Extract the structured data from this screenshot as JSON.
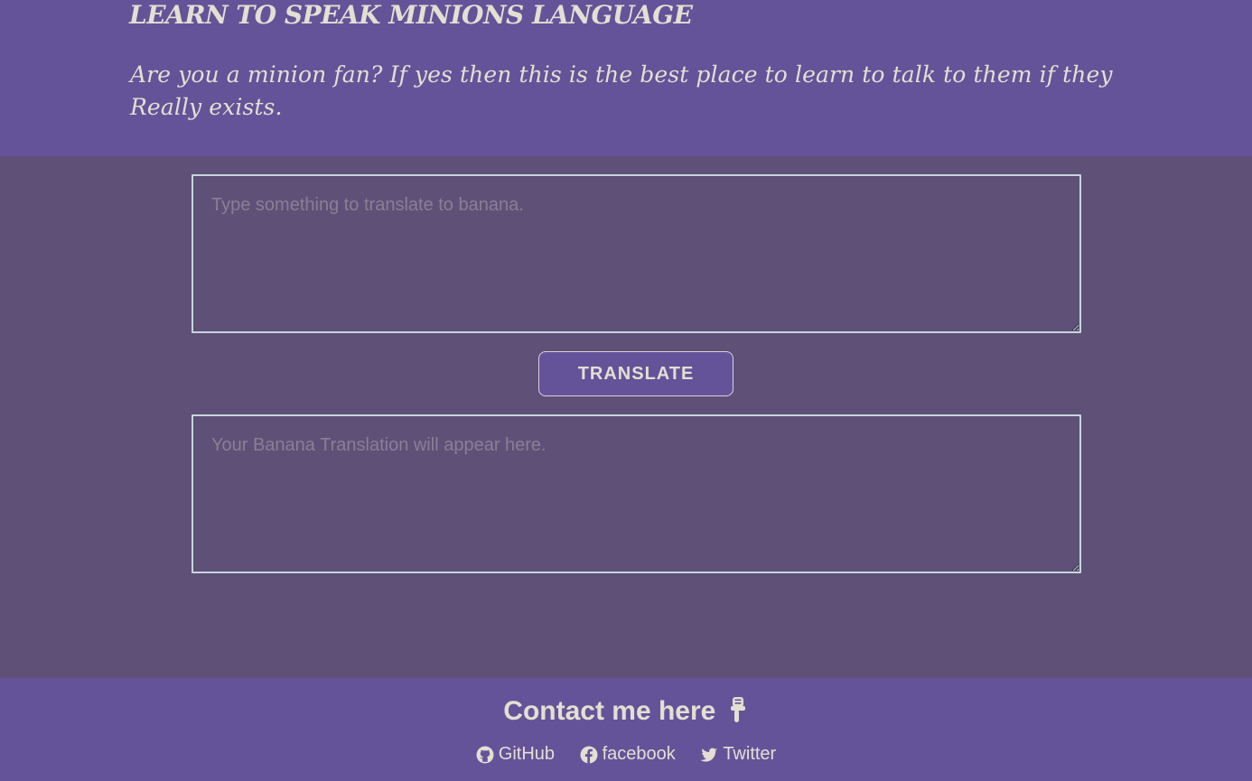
{
  "header": {
    "title": "LEARN TO SPEAK MINIONS LANGUAGE",
    "subtitle": "Are you a minion fan? If yes then this is the best place to learn to talk to them if they Really exists."
  },
  "translator": {
    "input_placeholder": "Type something to translate to banana.",
    "input_value": "",
    "button_label": "TRANSLATE",
    "output_placeholder": "Your Banana Translation will appear here.",
    "output_value": ""
  },
  "footer": {
    "heading": "Contact me here",
    "heading_icon": "pointing-down-hand-icon",
    "links": [
      {
        "label": "GitHub",
        "icon": "github-icon"
      },
      {
        "label": "facebook",
        "icon": "facebook-icon"
      },
      {
        "label": "Twitter",
        "icon": "twitter-icon"
      }
    ]
  },
  "colors": {
    "header_bg": "#645399",
    "main_bg": "#5f5078",
    "text": "#e4dfd2",
    "border": "#c5d5de"
  }
}
